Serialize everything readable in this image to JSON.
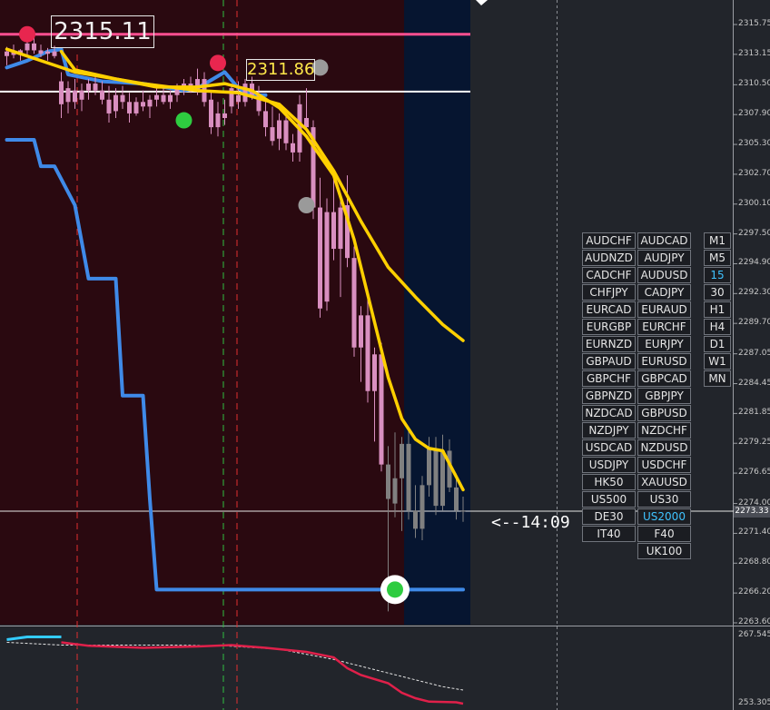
{
  "colors": {
    "background": "#22252b",
    "zone_dark_red": "#2a0910",
    "zone_navy": "#061530",
    "bull_candle": "#d98fc0",
    "bear_candle": "#808080",
    "ma_yellow": "#ffd000",
    "line_blue": "#3f8ae8",
    "line_pink": "#ff4f90",
    "osc_cyan": "#33ccff",
    "osc_red": "#e0204a"
  },
  "price_labels": {
    "high_marker": "2315.11",
    "mid_marker": "2311.86"
  },
  "countdown": "<--14:09",
  "price_axis": {
    "ticks": [
      {
        "label": "2315.75",
        "value": 2315.75
      },
      {
        "label": "2313.15",
        "value": 2313.15
      },
      {
        "label": "2310.50",
        "value": 2310.5
      },
      {
        "label": "2307.90",
        "value": 2307.9
      },
      {
        "label": "2305.30",
        "value": 2305.3
      },
      {
        "label": "2302.70",
        "value": 2302.7
      },
      {
        "label": "2300.10",
        "value": 2300.1
      },
      {
        "label": "2297.50",
        "value": 2297.5
      },
      {
        "label": "2294.90",
        "value": 2294.9
      },
      {
        "label": "2292.30",
        "value": 2292.3
      },
      {
        "label": "2289.70",
        "value": 2289.7
      },
      {
        "label": "2287.05",
        "value": 2287.05
      },
      {
        "label": "2284.45",
        "value": 2284.45
      },
      {
        "label": "2281.85",
        "value": 2281.85
      },
      {
        "label": "2279.25",
        "value": 2279.25
      },
      {
        "label": "2276.65",
        "value": 2276.65
      },
      {
        "label": "2274.00",
        "value": 2274.0
      },
      {
        "label": "2271.40",
        "value": 2271.4
      },
      {
        "label": "2268.80",
        "value": 2268.8
      },
      {
        "label": "2266.20",
        "value": 2266.2
      },
      {
        "label": "2263.60",
        "value": 2263.6
      }
    ],
    "current_price": "2273.33"
  },
  "osc_axis": {
    "top": "267.5453",
    "bottom": "253.3057"
  },
  "symbols": [
    {
      "label": "AUDCHF"
    },
    {
      "label": "AUDCAD"
    },
    {
      "label": "AUDNZD"
    },
    {
      "label": "AUDJPY"
    },
    {
      "label": "CADCHF"
    },
    {
      "label": "AUDUSD"
    },
    {
      "label": "CHFJPY"
    },
    {
      "label": "CADJPY"
    },
    {
      "label": "EURCAD"
    },
    {
      "label": "EURAUD"
    },
    {
      "label": "EURGBP"
    },
    {
      "label": "EURCHF"
    },
    {
      "label": "EURNZD"
    },
    {
      "label": "EURJPY"
    },
    {
      "label": "GBPAUD"
    },
    {
      "label": "EURUSD"
    },
    {
      "label": "GBPCHF"
    },
    {
      "label": "GBPCAD"
    },
    {
      "label": "GBPNZD"
    },
    {
      "label": "GBPJPY"
    },
    {
      "label": "NZDCAD"
    },
    {
      "label": "GBPUSD"
    },
    {
      "label": "NZDJPY"
    },
    {
      "label": "NZDCHF"
    },
    {
      "label": "USDCAD"
    },
    {
      "label": "NZDUSD"
    },
    {
      "label": "USDJPY"
    },
    {
      "label": "USDCHF"
    },
    {
      "label": "HK50"
    },
    {
      "label": "XAUUSD"
    },
    {
      "label": "US500"
    },
    {
      "label": "US30"
    },
    {
      "label": "DE30"
    },
    {
      "label": "US2000",
      "active": true
    },
    {
      "label": "IT40"
    },
    {
      "label": "F40"
    },
    {
      "label": ""
    },
    {
      "label": "UK100"
    }
  ],
  "timeframes": [
    {
      "label": "M1"
    },
    {
      "label": "M5"
    },
    {
      "label": "15",
      "active": true
    },
    {
      "label": "30"
    },
    {
      "label": "H1"
    },
    {
      "label": "H4"
    },
    {
      "label": "D1"
    },
    {
      "label": "W1"
    },
    {
      "label": "MN"
    }
  ],
  "candles": [
    {
      "o": 2313.0,
      "h": 2313.8,
      "l": 2312.2,
      "c": 2313.4
    },
    {
      "o": 2313.4,
      "h": 2314.0,
      "l": 2312.8,
      "c": 2313.1
    },
    {
      "o": 2313.1,
      "h": 2313.6,
      "l": 2312.6,
      "c": 2313.5
    },
    {
      "o": 2313.5,
      "h": 2315.1,
      "l": 2313.0,
      "c": 2314.1
    },
    {
      "o": 2314.1,
      "h": 2314.6,
      "l": 2313.2,
      "c": 2313.5
    },
    {
      "o": 2313.5,
      "h": 2314.0,
      "l": 2312.9,
      "c": 2313.2
    },
    {
      "o": 2313.2,
      "h": 2313.7,
      "l": 2312.6,
      "c": 2313.4
    },
    {
      "o": 2313.4,
      "h": 2313.9,
      "l": 2312.8,
      "c": 2313.0
    },
    {
      "o": 2310.8,
      "h": 2311.6,
      "l": 2307.6,
      "c": 2308.8
    },
    {
      "o": 2309.0,
      "h": 2310.8,
      "l": 2308.0,
      "c": 2310.2
    },
    {
      "o": 2310.0,
      "h": 2311.0,
      "l": 2308.4,
      "c": 2309.0
    },
    {
      "o": 2309.2,
      "h": 2310.6,
      "l": 2308.2,
      "c": 2310.0
    },
    {
      "o": 2310.0,
      "h": 2311.0,
      "l": 2309.2,
      "c": 2310.6
    },
    {
      "o": 2310.6,
      "h": 2311.2,
      "l": 2309.6,
      "c": 2310.0
    },
    {
      "o": 2310.0,
      "h": 2310.8,
      "l": 2308.8,
      "c": 2309.2
    },
    {
      "o": 2309.2,
      "h": 2310.4,
      "l": 2307.2,
      "c": 2308.0
    },
    {
      "o": 2308.2,
      "h": 2310.2,
      "l": 2307.6,
      "c": 2309.6
    },
    {
      "o": 2309.6,
      "h": 2310.4,
      "l": 2308.4,
      "c": 2309.0
    },
    {
      "o": 2309.0,
      "h": 2309.8,
      "l": 2307.2,
      "c": 2308.0
    },
    {
      "o": 2308.0,
      "h": 2309.4,
      "l": 2307.8,
      "c": 2309.0
    },
    {
      "o": 2309.0,
      "h": 2310.0,
      "l": 2308.2,
      "c": 2308.6
    },
    {
      "o": 2308.6,
      "h": 2309.6,
      "l": 2307.6,
      "c": 2309.2
    },
    {
      "o": 2309.2,
      "h": 2310.2,
      "l": 2308.6,
      "c": 2309.6
    },
    {
      "o": 2309.6,
      "h": 2310.4,
      "l": 2308.8,
      "c": 2309.0
    },
    {
      "o": 2309.0,
      "h": 2310.0,
      "l": 2308.4,
      "c": 2309.6
    },
    {
      "o": 2309.6,
      "h": 2310.6,
      "l": 2309.0,
      "c": 2310.2
    },
    {
      "o": 2310.2,
      "h": 2311.0,
      "l": 2309.6,
      "c": 2310.6
    },
    {
      "o": 2310.6,
      "h": 2311.2,
      "l": 2309.8,
      "c": 2310.0
    },
    {
      "o": 2310.0,
      "h": 2311.9,
      "l": 2309.6,
      "c": 2311.0
    },
    {
      "o": 2311.0,
      "h": 2311.6,
      "l": 2308.6,
      "c": 2309.0
    },
    {
      "o": 2309.2,
      "h": 2310.0,
      "l": 2306.2,
      "c": 2306.8
    },
    {
      "o": 2306.8,
      "h": 2309.0,
      "l": 2306.0,
      "c": 2308.0
    },
    {
      "o": 2308.0,
      "h": 2309.2,
      "l": 2307.0,
      "c": 2307.6
    },
    {
      "o": 2308.6,
      "h": 2310.6,
      "l": 2308.0,
      "c": 2310.2
    },
    {
      "o": 2309.6,
      "h": 2310.8,
      "l": 2308.4,
      "c": 2309.0
    },
    {
      "o": 2309.0,
      "h": 2311.0,
      "l": 2308.6,
      "c": 2310.6
    },
    {
      "o": 2310.6,
      "h": 2311.2,
      "l": 2309.2,
      "c": 2309.6
    },
    {
      "o": 2309.6,
      "h": 2310.4,
      "l": 2307.8,
      "c": 2308.2
    },
    {
      "o": 2308.2,
      "h": 2309.0,
      "l": 2306.0,
      "c": 2306.8
    },
    {
      "o": 2306.8,
      "h": 2308.6,
      "l": 2305.2,
      "c": 2305.6
    },
    {
      "o": 2305.8,
      "h": 2308.0,
      "l": 2304.8,
      "c": 2307.4
    },
    {
      "o": 2307.4,
      "h": 2308.4,
      "l": 2304.8,
      "c": 2305.4
    },
    {
      "o": 2305.4,
      "h": 2306.2,
      "l": 2303.8,
      "c": 2304.6
    },
    {
      "o": 2304.6,
      "h": 2309.6,
      "l": 2303.8,
      "c": 2308.8
    },
    {
      "o": 2307.6,
      "h": 2310.2,
      "l": 2306.4,
      "c": 2306.8
    },
    {
      "o": 2306.8,
      "h": 2307.4,
      "l": 2298.8,
      "c": 2299.8
    },
    {
      "o": 2299.8,
      "h": 2302.4,
      "l": 2290.2,
      "c": 2291.0
    },
    {
      "o": 2291.6,
      "h": 2300.6,
      "l": 2290.8,
      "c": 2299.4
    },
    {
      "o": 2299.4,
      "h": 2302.4,
      "l": 2295.2,
      "c": 2296.2
    },
    {
      "o": 2296.2,
      "h": 2300.8,
      "l": 2292.0,
      "c": 2299.8
    },
    {
      "o": 2300.0,
      "h": 2302.6,
      "l": 2294.6,
      "c": 2295.4
    },
    {
      "o": 2295.4,
      "h": 2296.4,
      "l": 2286.8,
      "c": 2287.6
    },
    {
      "o": 2287.6,
      "h": 2291.2,
      "l": 2284.6,
      "c": 2290.4
    },
    {
      "o": 2290.4,
      "h": 2291.8,
      "l": 2282.8,
      "c": 2283.8
    },
    {
      "o": 2283.8,
      "h": 2287.6,
      "l": 2279.4,
      "c": 2287.0
    },
    {
      "o": 2287.0,
      "h": 2288.0,
      "l": 2276.8,
      "c": 2277.4
    },
    {
      "o": 2277.4,
      "h": 2279.0,
      "l": 2264.6,
      "c": 2274.4
    },
    {
      "o": 2274.0,
      "h": 2280.2,
      "l": 2272.8,
      "c": 2276.2
    },
    {
      "o": 2276.2,
      "h": 2279.8,
      "l": 2271.6,
      "c": 2279.2
    },
    {
      "o": 2279.2,
      "h": 2280.4,
      "l": 2272.6,
      "c": 2273.4
    },
    {
      "o": 2273.4,
      "h": 2275.6,
      "l": 2271.0,
      "c": 2271.8
    },
    {
      "o": 2271.8,
      "h": 2276.4,
      "l": 2270.8,
      "c": 2275.6
    },
    {
      "o": 2275.6,
      "h": 2279.8,
      "l": 2274.6,
      "c": 2278.8
    },
    {
      "o": 2278.8,
      "h": 2279.8,
      "l": 2273.0,
      "c": 2273.8
    },
    {
      "o": 2273.8,
      "h": 2280.0,
      "l": 2273.4,
      "c": 2278.6
    },
    {
      "o": 2278.6,
      "h": 2279.6,
      "l": 2275.0,
      "c": 2275.4
    },
    {
      "o": 2275.4,
      "h": 2276.6,
      "l": 2272.6,
      "c": 2273.4
    },
    {
      "o": 2273.4,
      "h": 2274.6,
      "l": 2272.4,
      "c": 2273.3
    }
  ],
  "ma_slow": [
    [
      0,
      2313.6
    ],
    [
      10,
      2311.6
    ],
    [
      20,
      2310.6
    ],
    [
      28,
      2310.0
    ],
    [
      34,
      2309.8
    ],
    [
      40,
      2308.8
    ],
    [
      44,
      2306.6
    ],
    [
      48,
      2303.0
    ],
    [
      52,
      2298.6
    ],
    [
      56,
      2294.6
    ],
    [
      60,
      2292.0
    ],
    [
      64,
      2289.6
    ],
    [
      67,
      2288.2
    ]
  ],
  "ma_fast": [
    [
      8,
      2313.4
    ],
    [
      10,
      2311.8
    ],
    [
      16,
      2311.0
    ],
    [
      22,
      2310.3
    ],
    [
      28,
      2310.3
    ],
    [
      32,
      2310.6
    ],
    [
      36,
      2310.0
    ],
    [
      40,
      2308.5
    ],
    [
      44,
      2306.0
    ],
    [
      48,
      2302.6
    ],
    [
      51,
      2297.0
    ],
    [
      54,
      2289.8
    ],
    [
      56,
      2285.0
    ],
    [
      58,
      2281.4
    ],
    [
      60,
      2279.6
    ],
    [
      62,
      2278.8
    ],
    [
      64,
      2278.6
    ],
    [
      67,
      2275.2
    ]
  ],
  "blue_upper": [
    [
      0,
      2312.0
    ],
    [
      3,
      2312.6
    ],
    [
      6,
      2313.4
    ],
    [
      8,
      2313.6
    ],
    [
      9,
      2311.4
    ],
    [
      14,
      2310.8
    ],
    [
      20,
      2310.6
    ],
    [
      26,
      2310.0
    ],
    [
      28,
      2310.2
    ],
    [
      32,
      2311.6
    ],
    [
      34,
      2310.2
    ],
    [
      36,
      2309.6
    ],
    [
      38,
      2309.6
    ]
  ],
  "blue_lower": [
    [
      0,
      2305.7
    ],
    [
      4,
      2305.7
    ],
    [
      5,
      2303.4
    ],
    [
      7,
      2303.4
    ],
    [
      10,
      2300.0
    ],
    [
      12,
      2293.6
    ],
    [
      16,
      2293.6
    ],
    [
      17,
      2283.4
    ],
    [
      20,
      2283.4
    ],
    [
      21,
      2274.4
    ],
    [
      22,
      2266.5
    ],
    [
      67,
      2266.5
    ]
  ],
  "levels": {
    "pink_line": 2314.9,
    "white_line": 2309.9,
    "current": 2273.33
  },
  "markers": [
    {
      "type": "red",
      "index": 3,
      "price": 2314.9
    },
    {
      "type": "red",
      "index": 31,
      "price": 2312.4
    },
    {
      "type": "green",
      "index": 26,
      "price": 2307.4
    },
    {
      "type": "gray",
      "index": 46,
      "price": 2312.0
    },
    {
      "type": "gray",
      "index": 44,
      "price": 2300.0
    },
    {
      "type": "target",
      "index": 57,
      "price": 2266.5
    }
  ],
  "osc": {
    "signal": [
      [
        0,
        0.9
      ],
      [
        8,
        0.86
      ],
      [
        16,
        0.86
      ],
      [
        24,
        0.86
      ],
      [
        32,
        0.85
      ],
      [
        40,
        0.8
      ],
      [
        48,
        0.65
      ],
      [
        56,
        0.45
      ],
      [
        64,
        0.25
      ],
      [
        67,
        0.2
      ]
    ],
    "main_cyan": [
      [
        0,
        0.94
      ],
      [
        3,
        0.98
      ],
      [
        8,
        0.98
      ]
    ],
    "main_red": [
      [
        8,
        0.9
      ],
      [
        12,
        0.85
      ],
      [
        20,
        0.82
      ],
      [
        28,
        0.84
      ],
      [
        33,
        0.86
      ],
      [
        38,
        0.82
      ],
      [
        44,
        0.76
      ],
      [
        48,
        0.68
      ],
      [
        50,
        0.52
      ],
      [
        52,
        0.42
      ],
      [
        56,
        0.3
      ],
      [
        58,
        0.16
      ],
      [
        60,
        0.08
      ],
      [
        62,
        0.03
      ],
      [
        66,
        0.02
      ],
      [
        67,
        0.0
      ]
    ]
  }
}
